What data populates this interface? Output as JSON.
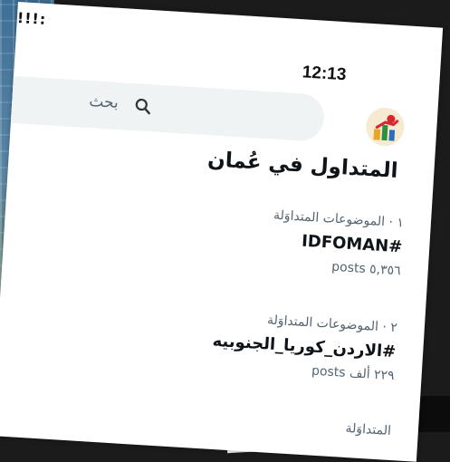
{
  "status_bar": {
    "signal": "!!!:",
    "time": "12:13"
  },
  "search": {
    "placeholder": "بحث",
    "icon": "search-icon"
  },
  "avatar": {
    "icon": "profile-logo-icon"
  },
  "title": "المتداول في عُمان",
  "trends": [
    {
      "context": "١ · الموضوعات المتداوَلة",
      "name": "#IDFOMAN",
      "count": "٥,٣٥٦ posts"
    },
    {
      "context": "٢ · الموضوعات المتداوَلة",
      "name": "#الاردن_كوريا_الجنوبيه",
      "count": "٢٢٩ ألف posts"
    },
    {
      "context": "المتداوَلة",
      "name": "",
      "count": ""
    }
  ],
  "colors": {
    "text_primary": "#0f1419",
    "text_secondary": "#536471",
    "search_bg": "#eff3f4"
  }
}
